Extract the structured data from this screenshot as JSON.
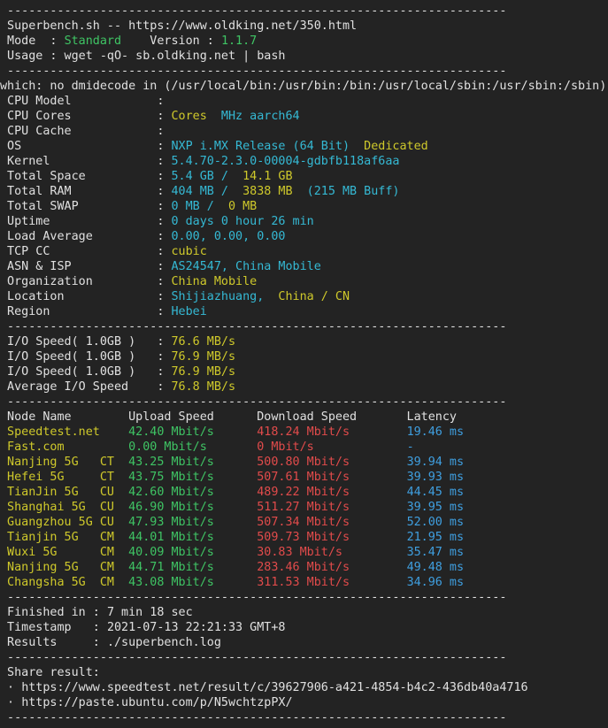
{
  "terminal": {
    "background_color": "#232323",
    "default_text_color": "#e0e0e0",
    "palette": {
      "white": "#e0e0e0",
      "cyan": "#35b9d4",
      "yellow": "#cfc92b",
      "green": "#3fc464",
      "red": "#e14b4b",
      "blue": "#3f9fe0"
    },
    "separator": "----------------------------------------------------------------------",
    "separator_short": "---------------------------------------------------------------------"
  },
  "header": {
    "title": "Superbench.sh -- https://www.oldking.net/350.html",
    "mode_label": "Mode  : ",
    "mode_value": "Standard",
    "version_label": "    Version : ",
    "version_value": "1.1.7",
    "usage": "Usage : wget -qO- sb.oldking.net | bash"
  },
  "warning": {
    "text": "which: no dmidecode in (/usr/local/bin:/usr/bin:/bin:/usr/local/sbin:/usr/sbin:/sbin)"
  },
  "sysinfo": {
    "rows": [
      {
        "label": "CPU Model",
        "parts": []
      },
      {
        "label": "CPU Cores",
        "parts": [
          {
            "text": " Cores ",
            "color": "yellow"
          },
          {
            "text": " MHz aarch64",
            "color": "cyan"
          }
        ]
      },
      {
        "label": "CPU Cache",
        "parts": []
      },
      {
        "label": "OS",
        "parts": [
          {
            "text": "NXP i.MX Release (64 Bit) ",
            "color": "cyan"
          },
          {
            "text": "Dedicated",
            "color": "yellow"
          }
        ]
      },
      {
        "label": "Kernel",
        "parts": [
          {
            "text": "5.4.70-2.3.0-00004-gdbfb118af6aa",
            "color": "cyan"
          }
        ]
      },
      {
        "label": "Total Space",
        "parts": [
          {
            "text": "5.4 GB / ",
            "color": "cyan"
          },
          {
            "text": "14.1 GB",
            "color": "yellow"
          }
        ]
      },
      {
        "label": "Total RAM",
        "parts": [
          {
            "text": "404 MB / ",
            "color": "cyan"
          },
          {
            "text": "3838 MB ",
            "color": "yellow"
          },
          {
            "text": "(215 MB Buff)",
            "color": "cyan"
          }
        ]
      },
      {
        "label": "Total SWAP",
        "parts": [
          {
            "text": "0 MB / ",
            "color": "cyan"
          },
          {
            "text": "0 MB",
            "color": "yellow"
          }
        ]
      },
      {
        "label": "Uptime",
        "parts": [
          {
            "text": "0 days 0 hour 26 min",
            "color": "cyan"
          }
        ]
      },
      {
        "label": "Load Average",
        "parts": [
          {
            "text": "0.00, 0.00, 0.00",
            "color": "cyan"
          }
        ]
      },
      {
        "label": "TCP CC",
        "parts": [
          {
            "text": "cubic",
            "color": "yellow"
          }
        ]
      },
      {
        "label": "ASN & ISP",
        "parts": [
          {
            "text": "AS24547, China Mobile",
            "color": "cyan"
          }
        ]
      },
      {
        "label": "Organization",
        "parts": [
          {
            "text": "China Mobile",
            "color": "yellow"
          }
        ]
      },
      {
        "label": "Location",
        "parts": [
          {
            "text": "Shijiazhuang, ",
            "color": "cyan"
          },
          {
            "text": "China / CN",
            "color": "yellow"
          }
        ]
      },
      {
        "label": "Region",
        "parts": [
          {
            "text": "Hebei",
            "color": "cyan"
          }
        ]
      }
    ]
  },
  "io": {
    "rows": [
      {
        "label": "I/O Speed( 1.0GB )",
        "value": "76.6 MB/s"
      },
      {
        "label": "I/O Speed( 1.0GB )",
        "value": "76.9 MB/s"
      },
      {
        "label": "I/O Speed( 1.0GB )",
        "value": "76.9 MB/s"
      },
      {
        "label": "Average I/O Speed",
        "value": "76.8 MB/s"
      }
    ]
  },
  "speedtest": {
    "columns": [
      "Node Name",
      "Upload Speed",
      "Download Speed",
      "Latency"
    ],
    "rows": [
      {
        "node": "Speedtest.net",
        "isp": "",
        "upload": "42.40 Mbit/s",
        "download": "418.24 Mbit/s",
        "latency": "19.46 ms"
      },
      {
        "node": "Fast.com",
        "isp": "",
        "upload": "0.00 Mbit/s",
        "download": "0 Mbit/s",
        "latency": "-"
      },
      {
        "node": "Nanjing 5G",
        "isp": "CT",
        "upload": "43.25 Mbit/s",
        "download": "500.80 Mbit/s",
        "latency": "39.94 ms"
      },
      {
        "node": "Hefei 5G",
        "isp": "CT",
        "upload": "43.75 Mbit/s",
        "download": "507.61 Mbit/s",
        "latency": "39.93 ms"
      },
      {
        "node": "TianJin 5G",
        "isp": "CU",
        "upload": "42.60 Mbit/s",
        "download": "489.22 Mbit/s",
        "latency": "44.45 ms"
      },
      {
        "node": "Shanghai 5G",
        "isp": "CU",
        "upload": "46.90 Mbit/s",
        "download": "511.27 Mbit/s",
        "latency": "39.95 ms"
      },
      {
        "node": "Guangzhou 5G",
        "isp": "CU",
        "upload": "47.93 Mbit/s",
        "download": "507.34 Mbit/s",
        "latency": "52.00 ms"
      },
      {
        "node": "Tianjin 5G",
        "isp": "CM",
        "upload": "44.01 Mbit/s",
        "download": "509.73 Mbit/s",
        "latency": "21.95 ms"
      },
      {
        "node": "Wuxi 5G",
        "isp": "CM",
        "upload": "40.09 Mbit/s",
        "download": "30.83 Mbit/s",
        "latency": "35.47 ms"
      },
      {
        "node": "Nanjing 5G",
        "isp": "CM",
        "upload": "44.71 Mbit/s",
        "download": "283.46 Mbit/s",
        "latency": "49.48 ms"
      },
      {
        "node": "Changsha 5G",
        "isp": "CM",
        "upload": "43.08 Mbit/s",
        "download": "311.53 Mbit/s",
        "latency": "34.96 ms"
      }
    ]
  },
  "summary": {
    "rows": [
      {
        "label": "Finished in ",
        "value": "7 min 18 sec"
      },
      {
        "label": "Timestamp   ",
        "value": "2021-07-13 22:21:33 GMT+8"
      },
      {
        "label": "Results     ",
        "value": "./superbench.log"
      }
    ]
  },
  "share": {
    "title": "Share result:",
    "bullet": "·",
    "links": [
      "https://www.speedtest.net/result/c/39627906-a421-4854-b4c2-436db40a4716",
      "https://paste.ubuntu.com/p/N5wchtzpPX/"
    ]
  }
}
